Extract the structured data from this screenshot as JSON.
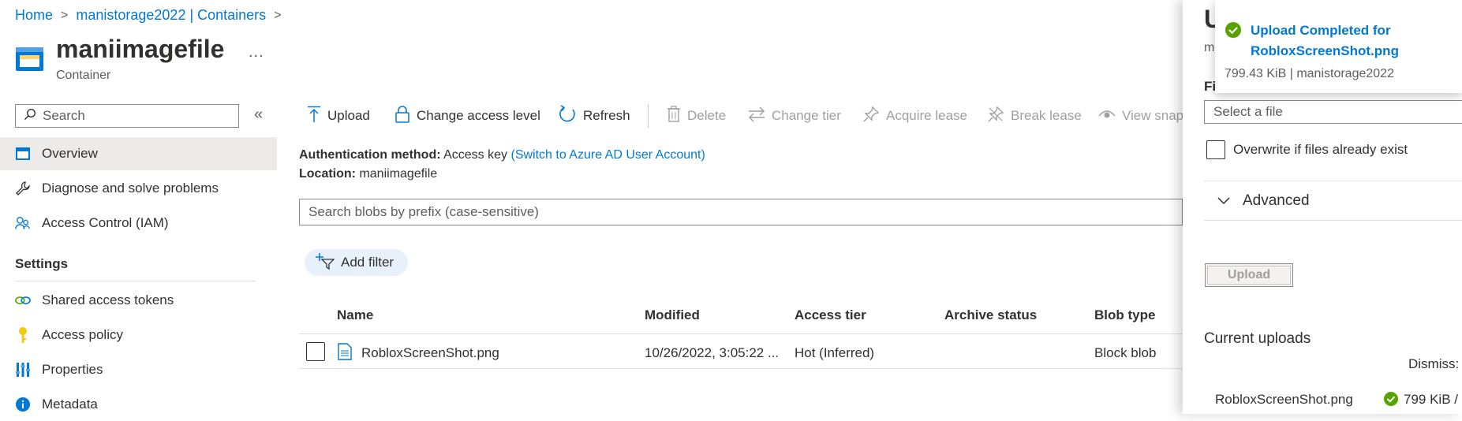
{
  "breadcrumb": {
    "home": "Home",
    "storage": "manistorage2022 | Containers"
  },
  "header": {
    "title": "maniimagefile",
    "subtitle": "Container",
    "more": "..."
  },
  "sidebar": {
    "search_placeholder": "Search",
    "items": [
      {
        "label": "Overview",
        "icon": "overview-icon"
      },
      {
        "label": "Diagnose and solve problems",
        "icon": "wrench-icon"
      },
      {
        "label": "Access Control (IAM)",
        "icon": "people-icon"
      }
    ],
    "settings_heading": "Settings",
    "settings_items": [
      {
        "label": "Shared access tokens",
        "icon": "link-icon"
      },
      {
        "label": "Access policy",
        "icon": "key-icon"
      },
      {
        "label": "Properties",
        "icon": "properties-icon"
      },
      {
        "label": "Metadata",
        "icon": "info-icon"
      }
    ]
  },
  "toolbar": {
    "upload": "Upload",
    "change_access": "Change access level",
    "refresh": "Refresh",
    "delete": "Delete",
    "change_tier": "Change tier",
    "acquire_lease": "Acquire lease",
    "break_lease": "Break lease",
    "view_snapshots": "View snap"
  },
  "details": {
    "auth_label": "Authentication method:",
    "auth_value": "Access key",
    "auth_link": "(Switch to Azure AD User Account)",
    "location_label": "Location:",
    "location_value": "maniimagefile"
  },
  "blob_search": {
    "placeholder": "Search blobs by prefix (case-sensitive)"
  },
  "filter": {
    "add_filter": "Add filter"
  },
  "table": {
    "headers": {
      "name": "Name",
      "modified": "Modified",
      "access_tier": "Access tier",
      "archive_status": "Archive status",
      "blob_type": "Blob type"
    },
    "rows": [
      {
        "name": "RobloxScreenShot.png",
        "modified": "10/26/2022, 3:05:22 ...",
        "access_tier": "Hot (Inferred)",
        "archive_status": "",
        "blob_type": "Block blob"
      }
    ]
  },
  "upload_panel": {
    "title_partial": "U",
    "subtitle_partial": "m",
    "files_label_partial": "Fi",
    "file_select_placeholder": "Select a file",
    "overwrite_label": "Overwrite if files already exist",
    "advanced_label": "Advanced",
    "upload_button": "Upload",
    "current_uploads": "Current uploads",
    "dismiss": "Dismiss:",
    "upload_item": {
      "file": "RobloxScreenShot.png",
      "size": "799 KiB /"
    }
  },
  "toast": {
    "title": "Upload Completed for RobloxScreenShot.png",
    "detail": "799.43 KiB | manistorage2022",
    "status_color": "#57a300"
  },
  "colors": {
    "accent": "#0078d4",
    "success": "#57a300"
  }
}
